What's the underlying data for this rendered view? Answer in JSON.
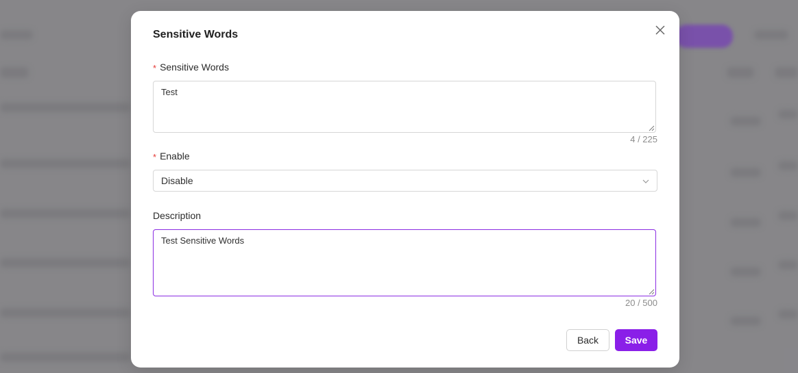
{
  "modal": {
    "title": "Sensitive Words",
    "close_icon": "close-icon"
  },
  "form": {
    "sensitive_words": {
      "label": "Sensitive Words",
      "required_mark": "*",
      "value": "Test",
      "counter": "4 / 225"
    },
    "enable": {
      "label": "Enable",
      "required_mark": "*",
      "selected": "Disable",
      "dropdown_icon": "chevron-down-icon"
    },
    "description": {
      "label": "Description",
      "value": "Test Sensitive Words",
      "counter": "20 / 500"
    }
  },
  "actions": {
    "back_label": "Back",
    "save_label": "Save"
  },
  "colors": {
    "accent": "#8a1fe8",
    "focus_border": "#8a2be2",
    "required": "#e53935"
  }
}
